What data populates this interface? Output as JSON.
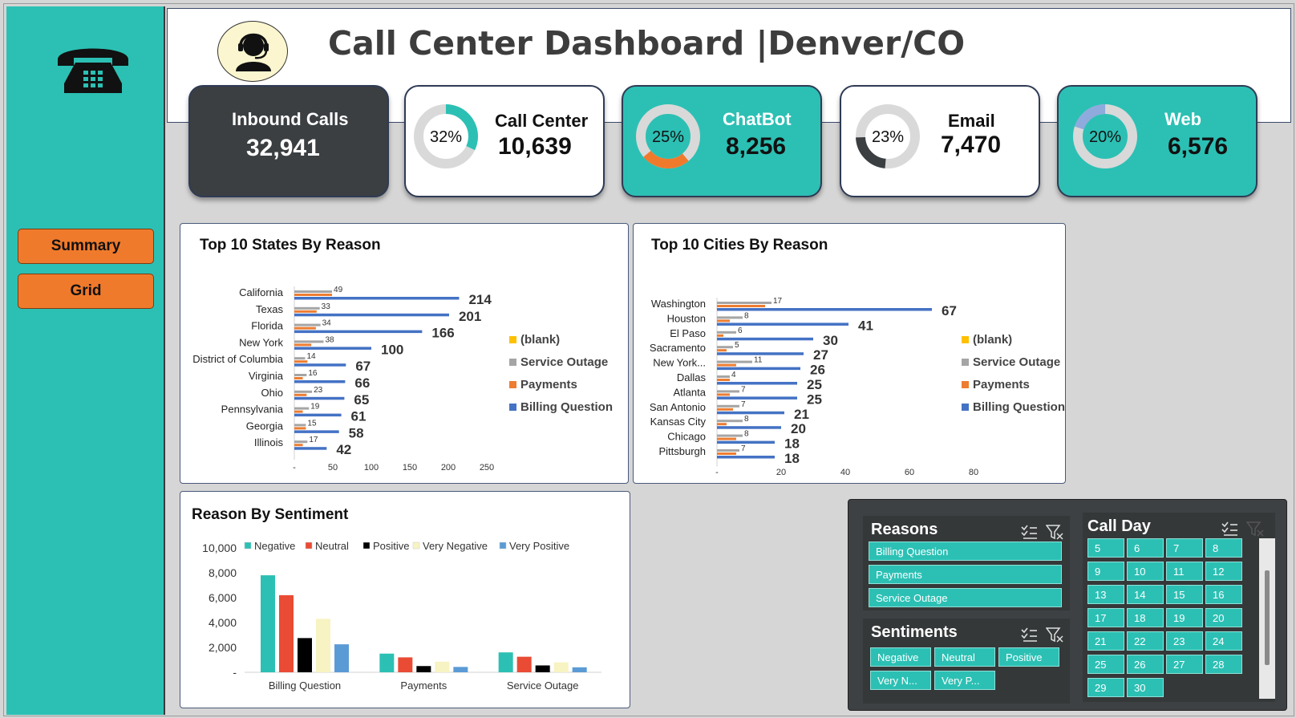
{
  "dashboard": {
    "title": "Call Center Dashboard |Denver/CO"
  },
  "nav": {
    "summary_label": "Summary",
    "grid_label": "Grid"
  },
  "kpis": {
    "inbound": {
      "label": "Inbound Calls",
      "value": "32,941"
    },
    "call_center": {
      "label": "Call Center",
      "value": "10,639",
      "pct_text": "32%",
      "pct": 32
    },
    "chatbot": {
      "label": "ChatBot",
      "value": "8,256",
      "pct_text": "25%",
      "pct": 25
    },
    "email": {
      "label": "Email",
      "value": "7,470",
      "pct_text": "23%",
      "pct": 23
    },
    "web": {
      "label": "Web",
      "value": "6,576",
      "pct_text": "20%",
      "pct": 20
    }
  },
  "colors": {
    "teal": "#2cc0b4",
    "orange": "#f07a2c",
    "dark": "#3b3f42",
    "billing": "#4472c4",
    "payments": "#ed7d31",
    "outage": "#a5a5a5",
    "blank": "#ffc000"
  },
  "chart_data": [
    {
      "type": "bar",
      "orientation": "horizontal",
      "title": "Top 10 States By Reason",
      "categories": [
        "California",
        "Texas",
        "Florida",
        "New York",
        "District of Columbia",
        "Virginia",
        "Ohio",
        "Pennsylvania",
        "Georgia",
        "Illinois"
      ],
      "series": [
        {
          "name": "Billing Question",
          "values": [
            214,
            201,
            166,
            100,
            67,
            66,
            65,
            61,
            58,
            42
          ]
        },
        {
          "name": "Payments",
          "values": [
            49,
            29,
            28,
            22,
            17,
            11,
            16,
            11,
            15,
            11
          ]
        },
        {
          "name": "Service Outage",
          "values": [
            49,
            33,
            34,
            38,
            14,
            16,
            23,
            19,
            15,
            17
          ]
        },
        {
          "name": "(blank)",
          "values": [
            0,
            0,
            0,
            0,
            0,
            0,
            0,
            0,
            0,
            0
          ]
        }
      ],
      "value_labels": [
        "214",
        "201",
        "166",
        "100",
        "67",
        "66",
        "65",
        "61",
        "58",
        "42"
      ],
      "xticks": [
        "-",
        "50",
        "100",
        "150",
        "200",
        "250"
      ],
      "xlim": [
        0,
        250
      ],
      "legend": [
        "(blank)",
        "Service Outage",
        "Payments",
        "Billing Question"
      ]
    },
    {
      "type": "bar",
      "orientation": "horizontal",
      "title": "Top 10 Cities By Reason",
      "categories": [
        "Washington",
        "Houston",
        "El Paso",
        "Sacramento",
        "New York...",
        "Dallas",
        "Atlanta",
        "San Antonio",
        "Kansas City",
        "Chicago",
        "Pittsburgh"
      ],
      "series": [
        {
          "name": "Billing Question",
          "values": [
            67,
            41,
            30,
            27,
            26,
            25,
            25,
            21,
            20,
            18,
            18
          ]
        },
        {
          "name": "Payments",
          "values": [
            15,
            4,
            2,
            3,
            6,
            4,
            4,
            5,
            3,
            6,
            6
          ]
        },
        {
          "name": "Service Outage",
          "values": [
            17,
            8,
            6,
            5,
            11,
            4,
            7,
            7,
            8,
            8,
            7
          ]
        },
        {
          "name": "(blank)",
          "values": [
            0,
            0,
            0,
            0,
            0,
            0,
            0,
            0,
            0,
            0,
            0
          ]
        }
      ],
      "value_labels": [
        "67",
        "41",
        "30",
        "27",
        "26",
        "25",
        "25",
        "21",
        "20",
        "18",
        "18"
      ],
      "xticks": [
        "-",
        "20",
        "40",
        "60",
        "80"
      ],
      "xlim": [
        0,
        80
      ],
      "legend": [
        "(blank)",
        "Service Outage",
        "Payments",
        "Billing Question"
      ]
    },
    {
      "type": "bar",
      "title": "Reason By Sentiment",
      "categories": [
        "Billing Question",
        "Payments",
        "Service Outage"
      ],
      "series": [
        {
          "name": "Negative",
          "values": [
            7800,
            1500,
            1600
          ]
        },
        {
          "name": "Neutral",
          "values": [
            6200,
            1200,
            1250
          ]
        },
        {
          "name": "Positive",
          "values": [
            2750,
            500,
            550
          ]
        },
        {
          "name": "Very Negative",
          "values": [
            4300,
            850,
            800
          ]
        },
        {
          "name": "Very Positive",
          "values": [
            2250,
            430,
            400
          ]
        }
      ],
      "yticks": [
        "10,000",
        "8,000",
        "6,000",
        "4,000",
        "2,000",
        "-"
      ],
      "ylim": [
        0,
        10000
      ],
      "colors": [
        "#2cc0b4",
        "#e94b35",
        "#000000",
        "#f7f3c2",
        "#5b9bd5"
      ]
    }
  ],
  "slicers": {
    "reasons": {
      "title": "Reasons",
      "items": [
        "Billing Question",
        "Payments",
        "Service Outage"
      ]
    },
    "sentiments": {
      "title": "Sentiments",
      "items": [
        "Negative",
        "Neutral",
        "Positive",
        "Very N...",
        "Very P..."
      ]
    },
    "call_day": {
      "title": "Call Day",
      "items": [
        "5",
        "6",
        "7",
        "8",
        "9",
        "10",
        "11",
        "12",
        "13",
        "14",
        "15",
        "16",
        "17",
        "18",
        "19",
        "20",
        "21",
        "22",
        "23",
        "24",
        "25",
        "26",
        "27",
        "28",
        "29",
        "30"
      ]
    }
  }
}
